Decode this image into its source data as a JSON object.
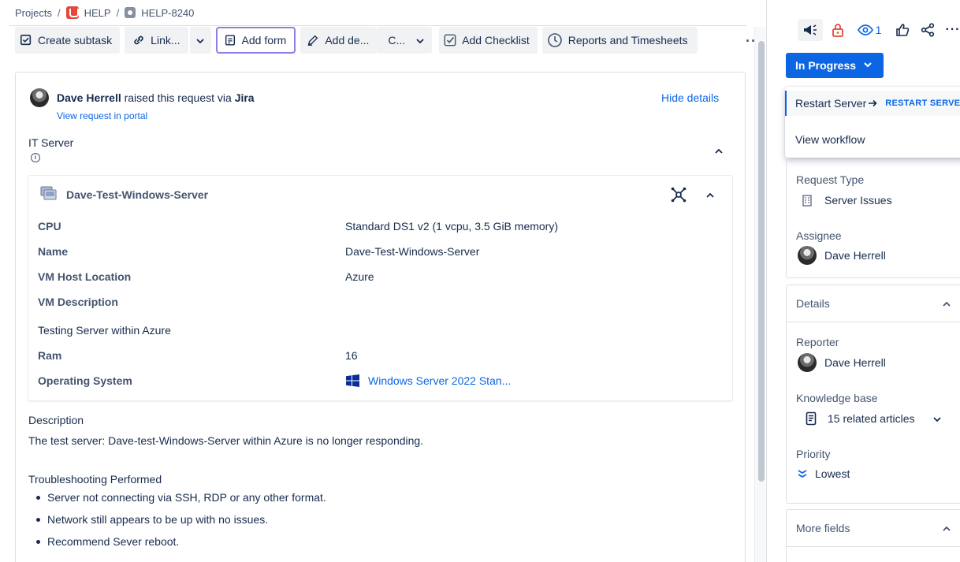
{
  "breadcrumb": {
    "projects": "Projects",
    "project": "HELP",
    "issue": "HELP-8240"
  },
  "toolbar": {
    "create_subtask": "Create subtask",
    "link": "Link...",
    "add_form": "Add form",
    "add_design": "Add de...",
    "c_menu": "C...",
    "add_checklist": "Add Checklist",
    "reports": "Reports and Timesheets"
  },
  "request": {
    "reporter": "Dave Herrell",
    "raised_text": "raised this request via",
    "channel": "Jira",
    "portal_link": "View request in portal",
    "hide_details": "Hide details"
  },
  "asset_section": {
    "label": "IT Server",
    "title": "Dave-Test-Windows-Server",
    "rows": [
      {
        "label": "CPU",
        "value": "Standard DS1 v2 (1 vcpu, 3.5 GiB memory)"
      },
      {
        "label": "Name",
        "value": "Dave-Test-Windows-Server"
      },
      {
        "label": "VM Host Location",
        "value": "Azure"
      },
      {
        "label": "VM Description",
        "value": ""
      },
      {
        "label": "Ram",
        "value": "16"
      },
      {
        "label": "Operating System",
        "value": "Windows Server 2022 Stan..."
      }
    ],
    "vm_description_text": "Testing Server within Azure"
  },
  "description": {
    "title": "Description",
    "text": "The test server: Dave-test-Windows-Server within Azure is no longer responding.",
    "troubleshooting_title": "Troubleshooting Performed",
    "bullets": [
      "Server not connecting via SSH, RDP or any other format.",
      "Network still appears to be up with no issues.",
      "Recommend Sever reboot."
    ]
  },
  "sidebar": {
    "watch_count": "1",
    "status": "In Progress",
    "transition": {
      "label": "Restart Server",
      "target": "RESTART SERVER"
    },
    "view_workflow": "View workflow",
    "request_type_label": "Request Type",
    "request_type": "Server Issues",
    "assignee_label": "Assignee",
    "assignee": "Dave Herrell",
    "details_title": "Details",
    "reporter_label": "Reporter",
    "reporter": "Dave Herrell",
    "kb_label": "Knowledge base",
    "kb_value": "15 related articles",
    "priority_label": "Priority",
    "priority": "Lowest",
    "more_fields": "More fields"
  },
  "colors": {
    "accent": "#0c66e4",
    "selected_border": "#8f7ee7",
    "lock": "#e34935"
  }
}
